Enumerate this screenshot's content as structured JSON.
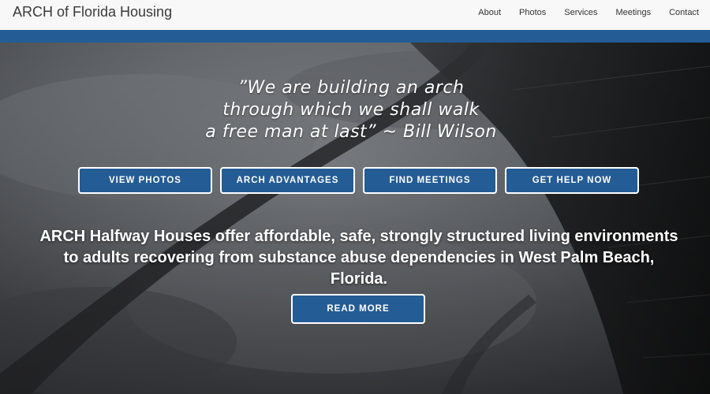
{
  "header": {
    "brand": "ARCH of Florida Housing",
    "nav": [
      "About",
      "Photos",
      "Services",
      "Meetings",
      "Contact"
    ]
  },
  "hero": {
    "quote_lines": [
      "”We are building an arch",
      "through which we shall walk",
      "a free man at last” ~ Bill Wilson"
    ],
    "buttons": [
      "VIEW PHOTOS",
      "ARCH ADVANTAGES",
      "FIND MEETINGS",
      "GET HELP NOW"
    ],
    "tagline_lines": [
      "ARCH Halfway Houses offer affordable, safe, strongly structured living environments",
      "to adults recovering from substance abuse dependencies in West Palm Beach,",
      "Florida."
    ],
    "read_more": "READ MORE"
  },
  "colors": {
    "accent_blue": "#245c95",
    "header_bg": "#f8f8f8",
    "text_white": "#ffffff"
  }
}
